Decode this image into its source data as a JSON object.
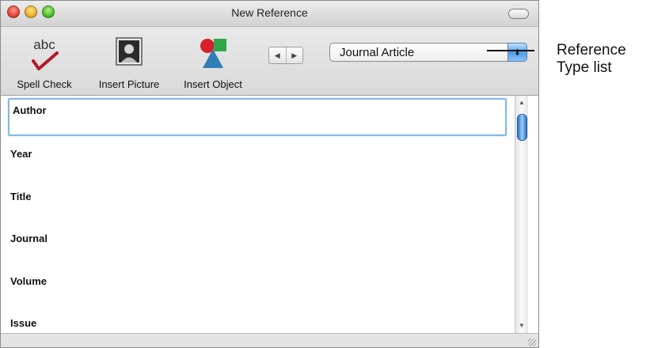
{
  "window": {
    "title": "New Reference",
    "colors": {
      "close": "#e84b3c",
      "minimize": "#f2b533",
      "zoom": "#58c432",
      "focus_ring": "#86b7e8",
      "select_accent": "#4f9ee6"
    }
  },
  "toolbar": {
    "spell_check": {
      "label": "Spell Check",
      "icon": "spell-check-icon",
      "icon_text": "abc"
    },
    "insert_picture": {
      "label": "Insert Picture",
      "icon": "portrait-picture-icon"
    },
    "insert_object": {
      "label": "Insert Object",
      "icon": "shapes-object-icon"
    },
    "nav": {
      "prev_icon": "◀",
      "next_icon": "▶"
    },
    "reference_type": {
      "selected": "Journal Article",
      "arrows_icon": "⬍"
    }
  },
  "fields": [
    {
      "label": "Author"
    },
    {
      "label": "Year"
    },
    {
      "label": "Title"
    },
    {
      "label": "Journal"
    },
    {
      "label": "Volume"
    },
    {
      "label": "Issue"
    }
  ],
  "callout": {
    "line1": "Reference",
    "line2": "Type list"
  }
}
